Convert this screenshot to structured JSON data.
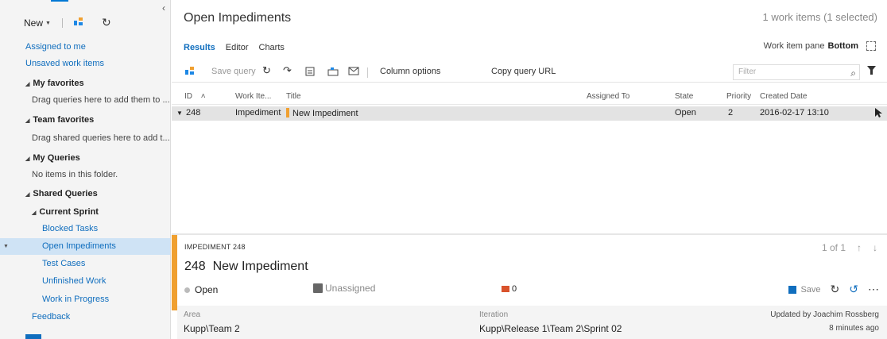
{
  "sidebar": {
    "new_label": "New",
    "collapse_glyph": "‹",
    "items": [
      {
        "label": "Assigned to me"
      },
      {
        "label": "Unsaved work items"
      },
      {
        "label": "My favorites"
      },
      {
        "label": "Drag queries here to add them to ..."
      },
      {
        "label": "Team favorites"
      },
      {
        "label": "Drag shared queries here to add t..."
      },
      {
        "label": "My Queries"
      },
      {
        "label": "No items in this folder."
      },
      {
        "label": "Shared Queries"
      },
      {
        "label": "Current Sprint"
      },
      {
        "label": "Blocked Tasks"
      },
      {
        "label": "Open Impediments"
      },
      {
        "label": "Test Cases"
      },
      {
        "label": "Unfinished Work"
      },
      {
        "label": "Work in Progress"
      },
      {
        "label": "Feedback"
      }
    ]
  },
  "header": {
    "title": "Open Impediments",
    "count": "1 work items (1 selected)"
  },
  "tabs": [
    {
      "label": "Results"
    },
    {
      "label": "Editor"
    },
    {
      "label": "Charts"
    }
  ],
  "pane": {
    "label": "Work item pane",
    "value": "Bottom"
  },
  "toolbar": {
    "save_query": "Save query",
    "column_options": "Column options",
    "copy_query_url": "Copy query URL",
    "filter_placeholder": "Filter"
  },
  "grid": {
    "columns": [
      "ID",
      "Work Ite...",
      "Title",
      "Assigned To",
      "State",
      "Priority",
      "Created Date"
    ],
    "rows": [
      {
        "id": "248",
        "type": "Impediment",
        "title": "New Impediment",
        "assigned": "",
        "state": "Open",
        "priority": "2",
        "created": "2016-02-17 13:10"
      }
    ]
  },
  "detail": {
    "label": "IMPEDIMENT 248",
    "id": "248",
    "title": "New Impediment",
    "pager": "1 of 1",
    "state": "Open",
    "assigned": "Unassigned",
    "discussion_count": "0",
    "save_label": "Save",
    "area_label": "Area",
    "area_value": "Kupp\\Team 2",
    "iteration_label": "Iteration",
    "iteration_value": "Kupp\\Release 1\\Team 2\\Sprint 02",
    "updated_by": "Updated by Joachim Rossberg",
    "updated_ago": "8 minutes ago"
  },
  "colors": {
    "accent": "#106ebe",
    "impediment": "#f0a030",
    "discussion": "#d9532c",
    "selected_nav": "#cfe3f5"
  }
}
